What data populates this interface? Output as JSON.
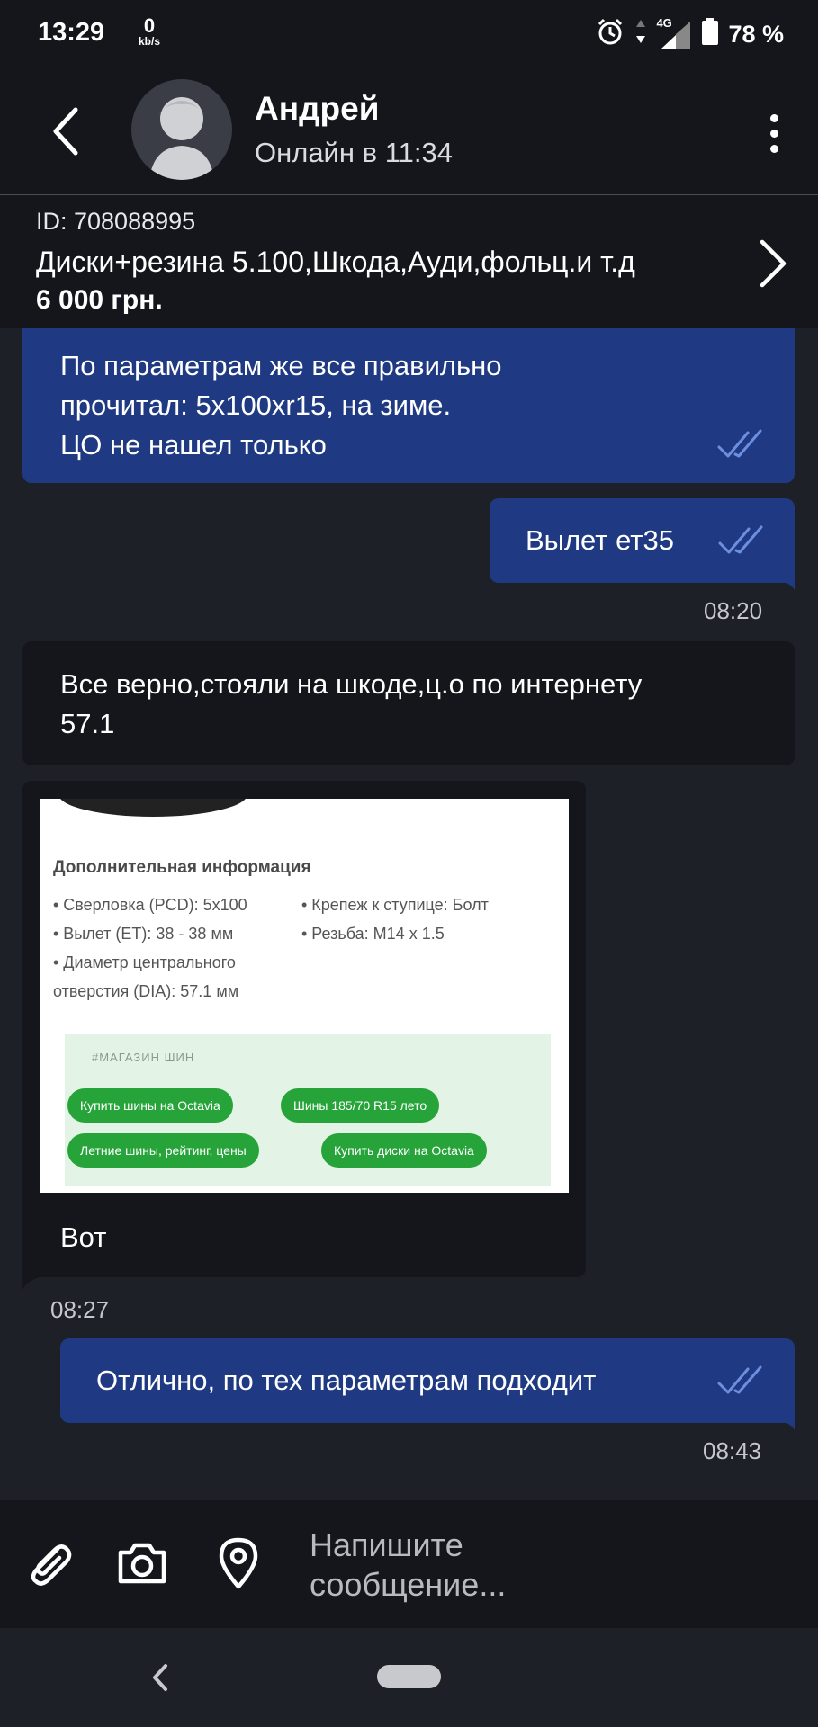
{
  "status_bar": {
    "time": "13:29",
    "speed_value": "0",
    "speed_unit": "kb/s",
    "network": "4G",
    "battery": "78 %"
  },
  "header": {
    "contact_name": "Андрей",
    "contact_status": "Онлайн в 11:34"
  },
  "ad": {
    "id": "ID: 708088995",
    "title": "Диски+резина 5.100,Шкода,Ауди,фольц.и т.д",
    "price": "6 000 грн."
  },
  "messages": [
    {
      "direction": "outgoing",
      "lines": [
        "По параметрам же все правильно",
        "прочитал: 5x100xr15, на зиме.",
        "ЦО не нашел только"
      ],
      "read": true
    },
    {
      "direction": "outgoing",
      "lines": [
        "Вылет ет35"
      ],
      "read": true,
      "time": "08:20"
    },
    {
      "direction": "incoming",
      "lines": [
        "Все верно,стояли на шкоде,ц.о по интернету",
        "57.1"
      ]
    },
    {
      "direction": "incoming",
      "lines": [
        "Вот"
      ],
      "time": "08:27",
      "has_image": true
    },
    {
      "direction": "outgoing",
      "lines": [
        "Отлично, по тех параметрам подходит"
      ],
      "read": true,
      "time": "08:43"
    }
  ],
  "image_content": {
    "heading": "Дополнительная информация",
    "specs_left": [
      "• Сверловка (PCD): 5x100",
      "• Вылет (ET): 38 - 38 мм",
      "• Диаметр центрального",
      "отверстия (DIA): 57.1 мм"
    ],
    "specs_right": [
      "• Крепеж к ступице: Болт",
      "• Резьба: M14 x 1.5"
    ],
    "tags_heading": "#МАГАЗИН ШИН",
    "tags": [
      "Купить шины на Octavia",
      "Шины 185/70 R15 лето",
      "Летние шины, рейтинг, цены",
      "Купить диски на Octavia"
    ]
  },
  "input": {
    "placeholder_line1": "Напишите",
    "placeholder_line2": "сообщение..."
  },
  "icons": [
    "back-arrow-icon",
    "avatar-icon",
    "more-vert-icon",
    "chevron-right-icon",
    "double-check-icon",
    "attach-icon",
    "camera-icon",
    "location-pin-icon",
    "alarm-icon",
    "signal-icon",
    "battery-icon"
  ],
  "colors": {
    "background": "#1e2027",
    "bar": "#14161c",
    "outgoing_bubble": "#1f3a82",
    "incoming_bubble": "#14161c",
    "read_ticks": "#6d8fe0",
    "chip": "#26a43a"
  }
}
